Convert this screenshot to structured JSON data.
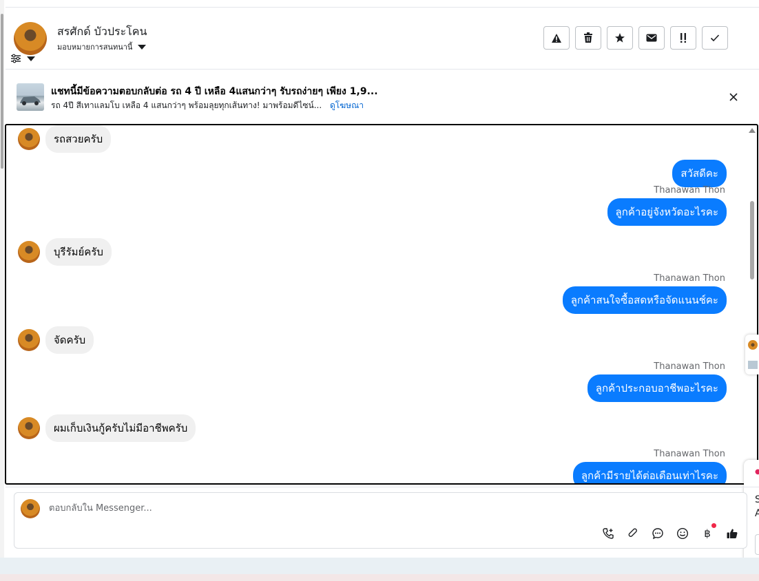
{
  "header": {
    "contact_name": "สรศักด์ บัวประโคน",
    "assign_label": "มอบหมายการสนทนานี้",
    "actions": [
      {
        "icon": "warning-icon"
      },
      {
        "icon": "trash-icon"
      },
      {
        "icon": "star-icon"
      },
      {
        "icon": "mail-icon"
      },
      {
        "icon": "follow-up-icon"
      },
      {
        "icon": "check-icon"
      }
    ]
  },
  "ad_banner": {
    "title": "แชทนี้มีข้อความตอบกลับต่อ รถ 4 ปี เหลือ 4แสนกว่าๆ รับรถง่ายๆ เพียง 1,9...",
    "subtitle": "รถ 4ปี สีเทาแลมโบ เหลือ 4 แสนกว่าๆ พร้อมลุยทุกเส้นทาง! มาพร้อมดีไซน์...",
    "link": "ดูโฆษณา"
  },
  "conversation": {
    "messages": [
      {
        "direction": "in",
        "text": "รถสวยครับ"
      },
      {
        "direction": "out",
        "sender": "",
        "text": "สวัสดีคะ"
      },
      {
        "direction": "out",
        "sender": "Thanawan Thon",
        "text": "ลูกค้าอยู่จังหวัดอะไรคะ"
      },
      {
        "direction": "in",
        "text": "บุรีรัมย์ครับ"
      },
      {
        "direction": "out",
        "sender": "Thanawan Thon",
        "text": "ลูกค้าสนใจซื้อสดหรือจัดแนนช์คะ"
      },
      {
        "direction": "in",
        "text": "จัดครับ"
      },
      {
        "direction": "out",
        "sender": "Thanawan Thon",
        "text": "ลูกค้าประกอบอาชีพอะไรคะ"
      },
      {
        "direction": "in",
        "text": "ผมเก็บเงินกู้ครับไม่มีอาชีพครับ"
      },
      {
        "direction": "out",
        "sender": "Thanawan Thon",
        "text": "ลูกค้ามีรายได้ต่อเดือนเท่าไรคะ"
      }
    ]
  },
  "composer": {
    "placeholder": "ตอบกลับใน Messenger...",
    "value": "",
    "baht_symbol": "฿",
    "tools": [
      "call-icon",
      "attachment-icon",
      "saved-reply-icon",
      "emoji-icon",
      "payment-icon",
      "like-icon"
    ]
  },
  "side_panel": {
    "line1": "S",
    "line2": "A"
  },
  "colors": {
    "outgoing_bubble": "#0a7cff",
    "incoming_bubble": "#f0f0f0",
    "link": "#0064d1"
  }
}
